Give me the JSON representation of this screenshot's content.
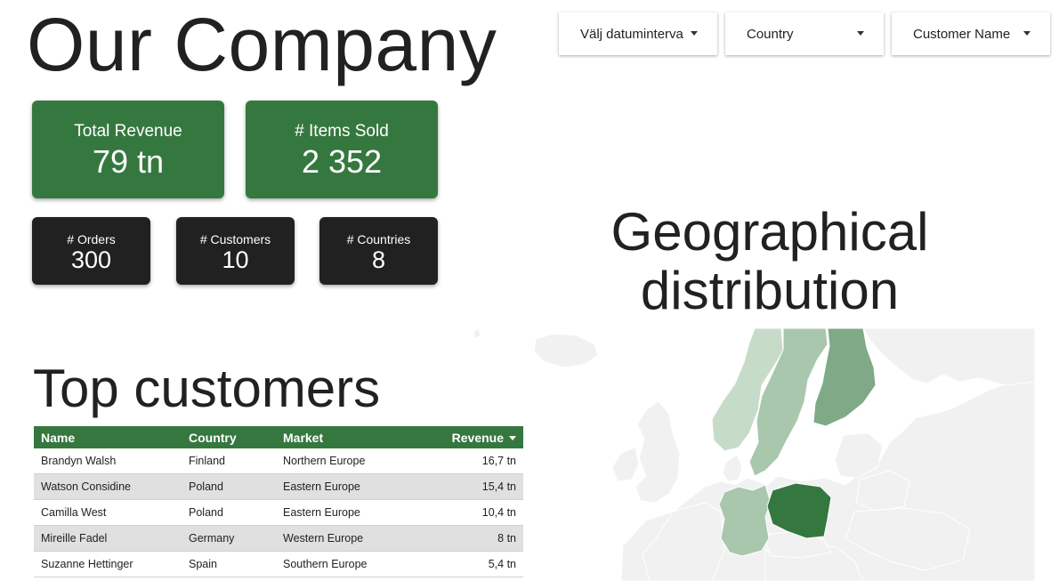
{
  "page_title": "Our Company",
  "filters": [
    {
      "label": "Välj datuminterva"
    },
    {
      "label": "Country"
    },
    {
      "label": "Customer Name"
    }
  ],
  "kpis": {
    "total_revenue": {
      "label": "Total Revenue",
      "value": "79 tn"
    },
    "items_sold": {
      "label": "# Items Sold",
      "value": "2 352"
    },
    "orders": {
      "label": "# Orders",
      "value": "300"
    },
    "customers": {
      "label": "# Customers",
      "value": "10"
    },
    "countries": {
      "label": "# Countries",
      "value": "8"
    }
  },
  "geo": {
    "title": "Geographical distribution",
    "colors": {
      "land": "#f1f1f1",
      "border": "#ffffff",
      "light": "#c7dbc9",
      "medium": "#a9c7ad",
      "dark": "#7fa987",
      "darkest": "#35783f"
    }
  },
  "top_customers": {
    "title": "Top customers",
    "columns": [
      "Name",
      "Country",
      "Market",
      "Revenue"
    ],
    "sort": "descending",
    "rows": [
      {
        "name": "Brandyn Walsh",
        "country": "Finland",
        "market": "Northern Europe",
        "revenue": "16,7 tn"
      },
      {
        "name": "Watson Considine",
        "country": "Poland",
        "market": "Eastern Europe",
        "revenue": "15,4 tn"
      },
      {
        "name": "Camilla West",
        "country": "Poland",
        "market": "Eastern Europe",
        "revenue": "10,4 tn"
      },
      {
        "name": "Mireille Fadel",
        "country": "Germany",
        "market": "Western Europe",
        "revenue": "8 tn"
      },
      {
        "name": "Suzanne Hettinger",
        "country": "Spain",
        "market": "Southern Europe",
        "revenue": "5,4 tn"
      }
    ]
  }
}
